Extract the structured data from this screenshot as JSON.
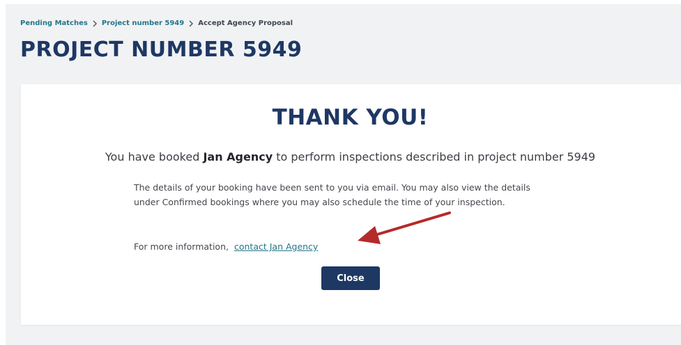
{
  "breadcrumb": {
    "items": [
      "Pending Matches",
      "Project number 5949"
    ],
    "current": "Accept Agency Proposal"
  },
  "page_title": "PROJECT NUMBER 5949",
  "card": {
    "heading": "THANK YOU!",
    "lead_prefix": "You have booked",
    "agency_name": "Jan Agency",
    "lead_suffix": "to perform inspections described in project number 5949",
    "details": "The details of your booking have been sent to you via email. You may also view the details under Confirmed bookings where you may also schedule the time of your inspection.",
    "more_info_prefix": "For more information,",
    "contact_link": "contact Jan Agency",
    "close_label": "Close"
  },
  "colors": {
    "title": "#1e3864",
    "link": "#24768a",
    "button_bg": "#1e3864",
    "annotation_arrow": "#b52a2a"
  }
}
